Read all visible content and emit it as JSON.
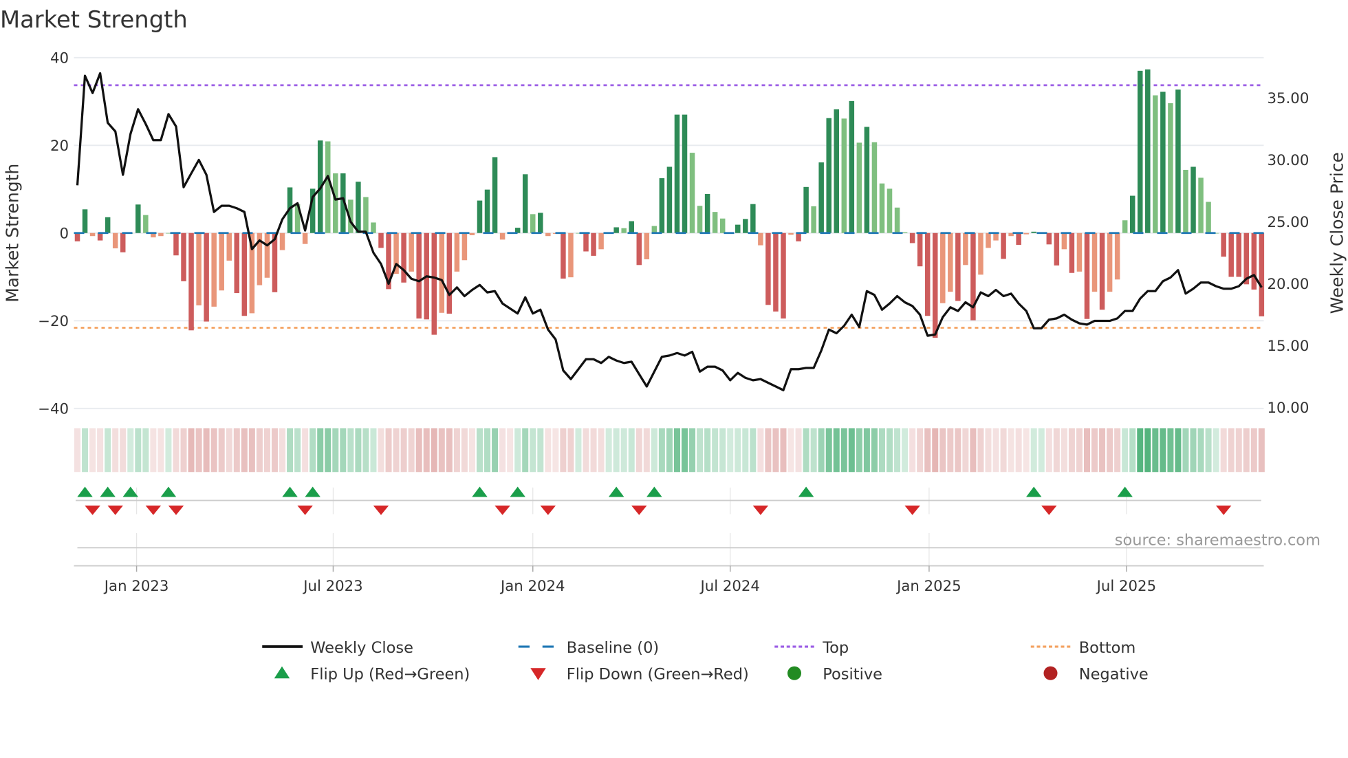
{
  "chart_data": {
    "type": "bar+line",
    "title": "Market Strength",
    "ylabel_left": "Market Strength",
    "ylabel_right": "Weekly Close Price",
    "ylim_left": [
      -40,
      40
    ],
    "ylim_right": [
      10,
      37.5
    ],
    "yticks_left": [
      "40",
      "20",
      "0",
      "−20",
      "−40"
    ],
    "yticks_left_values": [
      40,
      20,
      0,
      -20,
      -40
    ],
    "yticks_right": [
      "35.00",
      "30.00",
      "25.00",
      "20.00",
      "15.00",
      "10.00"
    ],
    "yticks_right_values": [
      35,
      30,
      25,
      20,
      15,
      10
    ],
    "x_unit": "week index",
    "xticks": [
      {
        "label": "Jan 2023",
        "week": 7.8
      },
      {
        "label": "Jul 2023",
        "week": 33.7
      },
      {
        "label": "Jan 2024",
        "week": 60.0
      },
      {
        "label": "Jul 2024",
        "week": 86.0
      },
      {
        "label": "Jan 2025",
        "week": 112.2
      },
      {
        "label": "Jul 2025",
        "week": 138.2
      }
    ],
    "top_level": 33.7,
    "bottom_level": -21.6,
    "baseline": 0,
    "strength": [
      -1.9,
      5.4,
      -0.7,
      -1.7,
      3.6,
      -3.5,
      -4.4,
      0,
      6.5,
      4.1,
      -1,
      -0.7,
      0,
      -5.1,
      -11,
      -22.2,
      -16.5,
      -20.2,
      -16.8,
      -13.1,
      -6.3,
      -13.7,
      -18.9,
      -18.3,
      -11.9,
      -10.2,
      -13.5,
      -3.9,
      10.4,
      6.6,
      -2.5,
      10.1,
      21.1,
      20.9,
      13.6,
      13.6,
      7.6,
      11.7,
      8.2,
      2.4,
      -3.4,
      -12.8,
      -9.3,
      -11.3,
      -8.8,
      -19.5,
      -19.7,
      -23.2,
      -18.2,
      -18.4,
      -8.8,
      -6.2,
      -0.5,
      7.4,
      9.9,
      17.3,
      -1.5,
      -0.2,
      1.2,
      13.4,
      4.3,
      4.6,
      -0.7,
      -0.2,
      -10.4,
      -10.1,
      0,
      -4.2,
      -5.2,
      -3.7,
      0,
      1.3,
      1.1,
      2.7,
      -7.3,
      -6.0,
      1.6,
      12.5,
      15.1,
      27,
      27,
      18.3,
      6.2,
      8.9,
      4.8,
      3.3,
      0,
      1.9,
      3.2,
      6.6,
      -2.8,
      -16.4,
      -17.9,
      -19.5,
      -0.4,
      -1.9,
      10.5,
      6.1,
      16.1,
      26.2,
      28.2,
      26.1,
      30.1,
      20.6,
      24.2,
      20.7,
      11.3,
      10.1,
      5.8,
      0.2,
      -2.3,
      -7.6,
      -18.9,
      -23.9,
      -16,
      -13.4,
      -15.5,
      -7.3,
      -19.9,
      -9.5,
      -3.4,
      -1.7,
      -5.9,
      -0.7,
      -2.7,
      -0.3,
      0.3,
      0,
      -2.6,
      -7.4,
      -3.7,
      -9.1,
      -8.8,
      -19.6,
      -13.4,
      -17.5,
      -13.4,
      -10.6,
      2.9,
      8.5,
      37,
      37.3,
      31.4,
      32.2,
      29.6,
      32.7,
      14.4,
      15.1,
      12.6,
      7.1,
      0,
      -5.4,
      -10,
      -10,
      -11.7,
      -12.9,
      -19
    ],
    "weekly_close": [
      27.95,
      36.8,
      35.4,
      37.0,
      33.0,
      32.3,
      28.8,
      32.1,
      34.1,
      32.9,
      31.6,
      31.6,
      33.7,
      32.7,
      27.8,
      28.9,
      30.0,
      28.8,
      25.8,
      26.3,
      26.3,
      26.1,
      25.8,
      22.8,
      23.5,
      23.1,
      23.6,
      25.2,
      26.1,
      26.5,
      24.3,
      27.0,
      27.7,
      28.7,
      26.8,
      26.9,
      25.0,
      24.2,
      24.2,
      22.5,
      21.6,
      20.0,
      21.6,
      21.1,
      20.4,
      20.2,
      20.6,
      20.5,
      20.3,
      19.1,
      19.7,
      19.0,
      19.5,
      19.9,
      19.3,
      19.4,
      18.4,
      18.0,
      17.6,
      18.9,
      17.6,
      17.9,
      16.3,
      15.5,
      13.0,
      12.3,
      13.1,
      13.9,
      13.9,
      13.6,
      14.1,
      13.8,
      13.6,
      13.7,
      12.7,
      11.7,
      12.9,
      14.1,
      14.2,
      14.4,
      14.2,
      14.5,
      12.9,
      13.3,
      13.3,
      13.0,
      12.2,
      12.8,
      12.4,
      12.2,
      12.3,
      12.0,
      11.7,
      11.4,
      13.1,
      13.1,
      13.2,
      13.2,
      14.6,
      16.3,
      16.0,
      16.6,
      17.5,
      16.5,
      19.4,
      19.1,
      17.9,
      18.4,
      19.0,
      18.5,
      18.2,
      17.5,
      15.8,
      15.9,
      17.3,
      18.1,
      17.8,
      18.5,
      18.1,
      19.3,
      19.0,
      19.5,
      19.0,
      19.2,
      18.4,
      17.8,
      16.4,
      16.4,
      17.1,
      17.2,
      17.5,
      17.1,
      16.8,
      16.7,
      17.0,
      17.0,
      17.0,
      17.2,
      17.8,
      17.8,
      18.8,
      19.4,
      19.4,
      20.2,
      20.5,
      21.1,
      19.2,
      19.6,
      20.1,
      20.1,
      19.8,
      19.6,
      19.6,
      19.8,
      20.4,
      20.7,
      19.7
    ],
    "flip_up_weeks": [
      1,
      4,
      7,
      12,
      28,
      31,
      53,
      58,
      71,
      76,
      96,
      126,
      138
    ],
    "flip_down_weeks": [
      2,
      5,
      10,
      13,
      30,
      40,
      56,
      62,
      74,
      90,
      110,
      128,
      151
    ],
    "legend": {
      "placement": "bottom",
      "items": [
        {
          "key": "weekly_close",
          "label": "Weekly Close",
          "symbol": "line",
          "color": "#111111"
        },
        {
          "key": "baseline",
          "label": "Baseline (0)",
          "symbol": "dash",
          "color": "#1f77b4"
        },
        {
          "key": "top",
          "label": "Top",
          "symbol": "dot",
          "color": "#9b5de5"
        },
        {
          "key": "bottom",
          "label": "Bottom",
          "symbol": "dot",
          "color": "#f4a261"
        },
        {
          "key": "flip_up",
          "label": "Flip Up (Red→Green)",
          "symbol": "tri-up",
          "color": "#1a9e4a"
        },
        {
          "key": "flip_down",
          "label": "Flip Down (Green→Red)",
          "symbol": "tri-down",
          "color": "#d62728"
        },
        {
          "key": "positive",
          "label": "Positive",
          "symbol": "circle",
          "color": "#228b22"
        },
        {
          "key": "negative",
          "label": "Negative",
          "symbol": "circle",
          "color": "#b22222"
        }
      ]
    },
    "source": "source: sharemaestro.com"
  },
  "colors": {
    "pos_dark": "#2e8b57",
    "pos_light": "#7fbf7f",
    "neg_dark": "#cd5c5c",
    "neg_light": "#e9967a",
    "heat_pos": "#2ca25f",
    "heat_neg": "#c0504d",
    "grid": "#e8ebef"
  }
}
